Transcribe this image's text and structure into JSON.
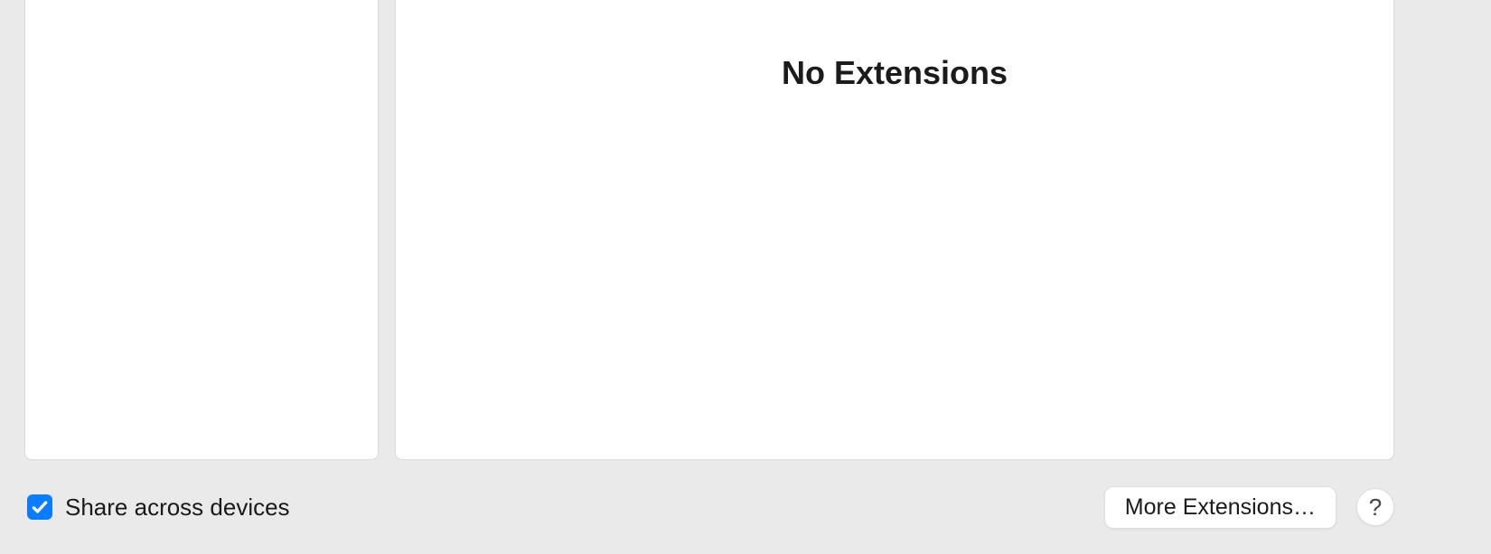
{
  "main": {
    "empty_title": "No Extensions"
  },
  "footer": {
    "share_checkbox": {
      "checked": true
    },
    "share_label": "Share across devices",
    "more_button_label": "More Extensions…",
    "help_label": "?"
  }
}
